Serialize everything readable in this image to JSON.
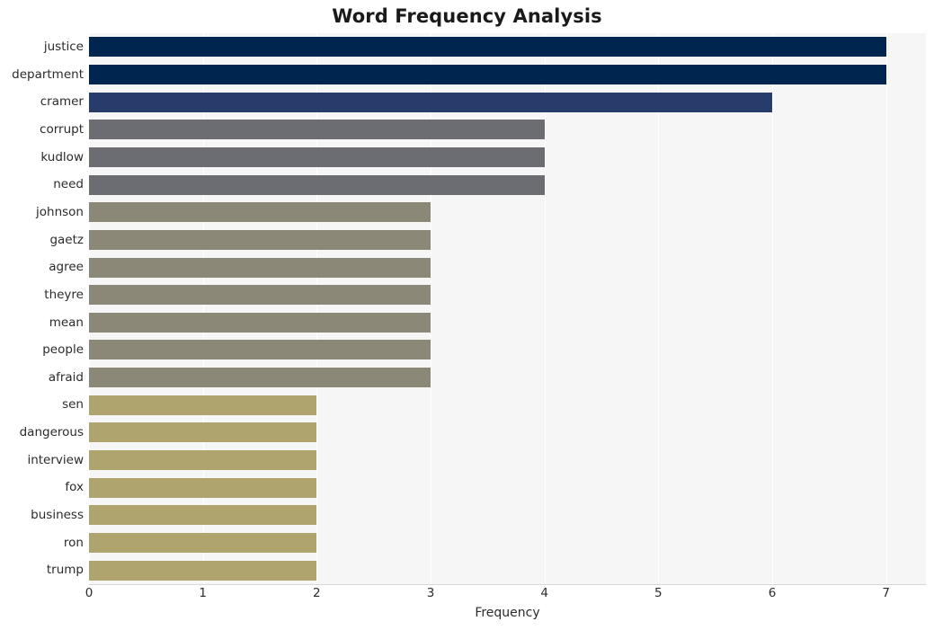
{
  "chart_data": {
    "type": "bar",
    "orientation": "horizontal",
    "title": "Word Frequency Analysis",
    "xlabel": "Frequency",
    "ylabel": "",
    "xlim": [
      0,
      7.35
    ],
    "xticks": [
      0,
      1,
      2,
      3,
      4,
      5,
      6,
      7
    ],
    "xticklabels": [
      "0",
      "1",
      "2",
      "3",
      "4",
      "5",
      "6",
      "7"
    ],
    "grid": "vertical",
    "legend": "none",
    "categories": [
      "justice",
      "department",
      "cramer",
      "corrupt",
      "kudlow",
      "need",
      "johnson",
      "gaetz",
      "agree",
      "theyre",
      "mean",
      "people",
      "afraid",
      "sen",
      "dangerous",
      "interview",
      "fox",
      "business",
      "ron",
      "trump"
    ],
    "values": [
      7,
      7,
      6,
      4,
      4,
      4,
      3,
      3,
      3,
      3,
      3,
      3,
      3,
      2,
      2,
      2,
      2,
      2,
      2,
      2
    ],
    "bar_colors": [
      "#00254f",
      "#00254f",
      "#273c6b",
      "#6b6d72",
      "#6b6d72",
      "#6b6d72",
      "#8c8878",
      "#8c8878",
      "#8c8878",
      "#8c8878",
      "#8c8878",
      "#8c8878",
      "#8c8878",
      "#b0a46e",
      "#b0a46e",
      "#b0a46e",
      "#b0a46e",
      "#b0a46e",
      "#b0a46e",
      "#b0a46e"
    ]
  },
  "style": {
    "plot_background": "#f6f6f7",
    "figure_background": "#ffffff",
    "gridline_color": "#ffffff",
    "text_color": "#2b2b2b",
    "title_color": "#1a1a1a"
  }
}
